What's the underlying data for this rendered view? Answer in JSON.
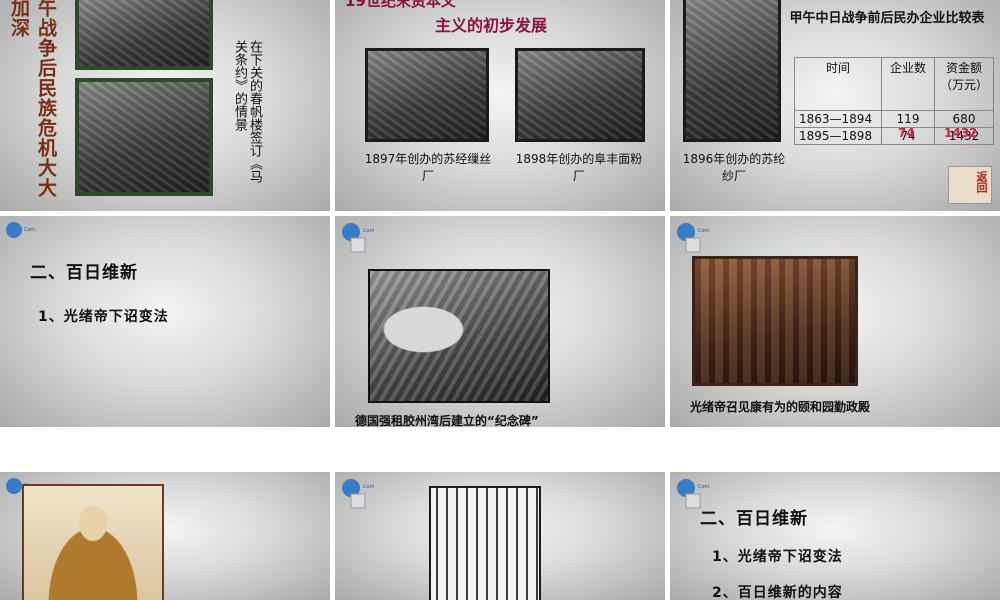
{
  "slides": {
    "s1": {
      "title_vertical": "午战争后民族危机大大加深",
      "caption_vertical": "在下关的春帆楼签订《马关条约》的情景"
    },
    "s2": {
      "title_line1": "19世纪末资本义",
      "title_line2": "主义的初步发展",
      "caption_left": "1897年创办的苏经缫丝厂",
      "caption_right": "1898年创办的阜丰面粉厂"
    },
    "s3": {
      "photo_caption": "1896年创办的苏纶纱厂",
      "table_title": "甲午中日战争前后民办企业比较表",
      "table_headers": [
        "时间",
        "企业数",
        "资金额（万元）"
      ],
      "table_rows": [
        [
          "1863—1894",
          "119",
          "680"
        ],
        [
          "1895—1898",
          "74",
          "1432"
        ]
      ],
      "overlay_red": [
        "74",
        "1432"
      ],
      "return_label": "返回"
    },
    "s4": {
      "heading": "二、百日维新",
      "item1": "1、光绪帝下诏变法"
    },
    "s5": {
      "caption": "德国强租胶州湾后建立的“纪念碑”"
    },
    "s6": {
      "caption": "光绪帝召见康有为的颐和园勤政殿"
    },
    "s9": {
      "heading": "二、百日维新",
      "item1": "1、光绪帝下诏变法",
      "item2": "2、百日维新的内容"
    }
  },
  "colors": {
    "title_brown": "#7a2f14",
    "maroon": "#8a1538",
    "table_red": "#cc2244"
  }
}
